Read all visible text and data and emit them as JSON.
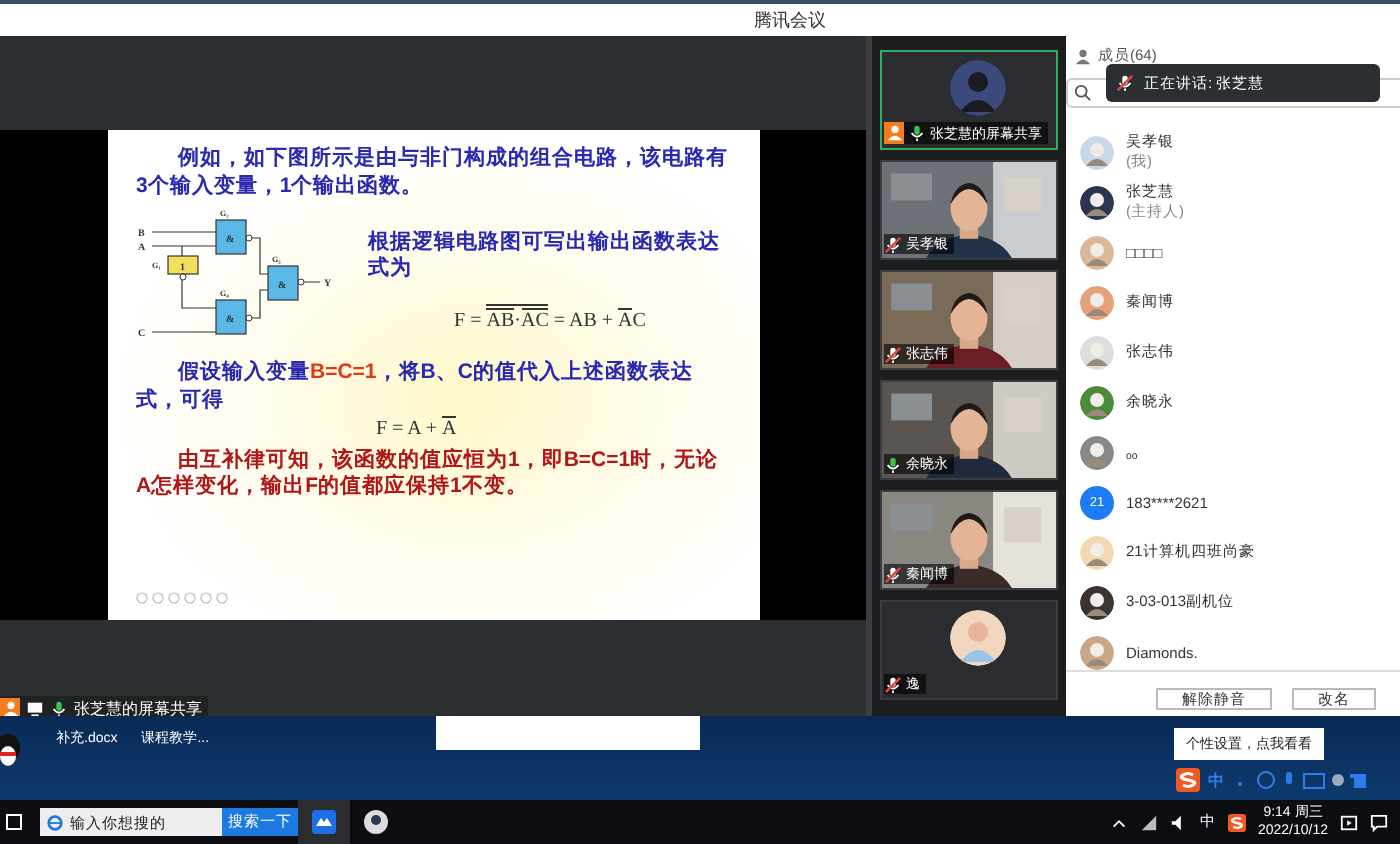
{
  "window": {
    "title": "腾讯会议"
  },
  "slide": {
    "intro": "例如，如下图所示是由与非门构成的组合电路，该电路有3个输入变量，1个输出函数。",
    "circuit_labels": [
      "B",
      "A",
      "C",
      "G₂",
      "G₁",
      "G₃",
      "G₄",
      "1",
      "&",
      "&",
      "&",
      "Y"
    ],
    "explain": "根据逻辑电路图可写出输出函数表达式为",
    "formula_1": [
      {
        "text": "F = ",
        "overlined": false
      },
      {
        "overlined": true,
        "parts": [
          {
            "text": "AB",
            "overlined": true
          },
          {
            "text": "·",
            "overlined": false
          },
          {
            "text": "AC",
            "overlined": true
          }
        ]
      },
      {
        "text": " = AB + ",
        "overlined": false
      },
      {
        "text": "A",
        "overlined": true
      },
      {
        "text": "C",
        "overlined": false
      }
    ],
    "assume": "假设输入变量**B=C=1**，将B、C的值代入上述函数表达式，可得",
    "formula_2": [
      {
        "text": "F = A + ",
        "overlined": false
      },
      {
        "text": "A",
        "overlined": true
      }
    ],
    "conclusion": "由互补律可知，该函数的值应恒为1，即B=C=1时，无论A怎样变化，输出F的值都应保持1不变。"
  },
  "share_label": "张芝慧的屏幕共享",
  "videos": [
    {
      "name": "张芝慧的屏幕共享",
      "kind": "avatar",
      "muted": false,
      "selected": true
    },
    {
      "name": "吴孝银",
      "kind": "camera",
      "muted": true,
      "selected": false
    },
    {
      "name": "张志伟",
      "kind": "camera",
      "muted": true,
      "selected": false
    },
    {
      "name": "余晓永",
      "kind": "camera",
      "muted": false,
      "selected": false
    },
    {
      "name": "秦闻博",
      "kind": "camera",
      "muted": true,
      "selected": false
    },
    {
      "name": "逸",
      "kind": "avatar",
      "muted": true,
      "selected": false
    }
  ],
  "members": {
    "title": "成员(64)",
    "speaking": "正在讲话: 张芝慧",
    "items": [
      {
        "name": "吴孝银",
        "role": "(我)",
        "kind": "picture"
      },
      {
        "name": "张芝慧",
        "role": "(主持人)",
        "kind": "picture"
      },
      {
        "name": "□□□□",
        "kind": "picture"
      },
      {
        "name": "秦闻博",
        "kind": "picture"
      },
      {
        "name": "张志伟",
        "kind": "picture"
      },
      {
        "name": "余晓永",
        "kind": "picture"
      },
      {
        "name": "ₒₒ",
        "kind": "picture"
      },
      {
        "name": "183****2621",
        "kind": "initials",
        "initials": "21"
      },
      {
        "name": "21计算机四班尚豪",
        "kind": "picture"
      },
      {
        "name": "3-03-013副机位",
        "kind": "picture"
      },
      {
        "name": "Diamonds.",
        "kind": "picture"
      }
    ],
    "buttons": [
      "解除静音",
      "改名"
    ]
  },
  "desktop": {
    "files": [
      "补充.docx",
      "课程教学..."
    ],
    "ime_tip": "个性设置，点我看看",
    "ime_mode": "中"
  },
  "taskbar": {
    "search_placeholder": "输入你想搜的",
    "search_button": "搜索一下",
    "input_mode": "中",
    "time": "9:14 周三",
    "date": "2022/10/12"
  }
}
